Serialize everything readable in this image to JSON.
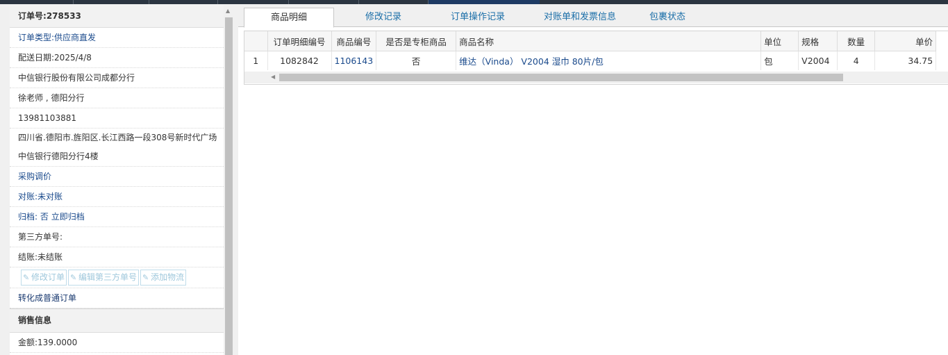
{
  "order": {
    "number_label": "订单号:",
    "number": "278533",
    "type_label": "订单类型:",
    "type": "供应商直发",
    "delivery_label": "配送日期:",
    "delivery_date": "2025/4/8",
    "company": "中信银行股份有限公司成都分行",
    "contact": "徐老师 , 德阳分行",
    "phone": "13981103881",
    "address": "四川省.德阳市.旌阳区.长江西路一段308号新时代广场中信银行德阳分行4楼",
    "price_adjust_link": "采购调价",
    "reconcile_label": "对账:",
    "reconcile_status": "未对账",
    "archive_label": "归档:",
    "archive_status": "否",
    "archive_now_link": "立即归档",
    "third_party_label": "第三方单号:",
    "settle_label": "结账:",
    "settle_status": "未结账",
    "btn_edit_order": "修改订单",
    "btn_edit_third": "编辑第三方单号",
    "btn_add_logistics": "添加物流",
    "convert_link": "转化成普通订单"
  },
  "sales": {
    "section_title": "销售信息",
    "amount_label": "金额:",
    "amount": "139.0000"
  },
  "tabs": [
    "商品明细",
    "修改记录",
    "订单操作记录",
    "对账单和发票信息",
    "包裹状态"
  ],
  "table": {
    "columns": [
      "订单明细编号",
      "商品编号",
      "是否是专柜商品",
      "商品名称",
      "单位",
      "规格",
      "数量",
      "单价"
    ],
    "rows": [
      {
        "index": "1",
        "detail_no": "1082842",
        "product_no": "1106143",
        "is_counter": "否",
        "name": "维达（Vinda） V2004 湿巾 80片/包",
        "unit": "包",
        "spec": "V2004",
        "qty": "4",
        "price": "34.75"
      }
    ]
  },
  "colors": {
    "link_blue": "#1a4a8c",
    "tab_blue": "#1a6ea8",
    "disabled_btn": "#9fc8dc"
  },
  "icons": {
    "edit": "pencil-edit-icon",
    "scroll_up": "triangle-up-icon",
    "scroll_left": "triangle-left-icon"
  }
}
